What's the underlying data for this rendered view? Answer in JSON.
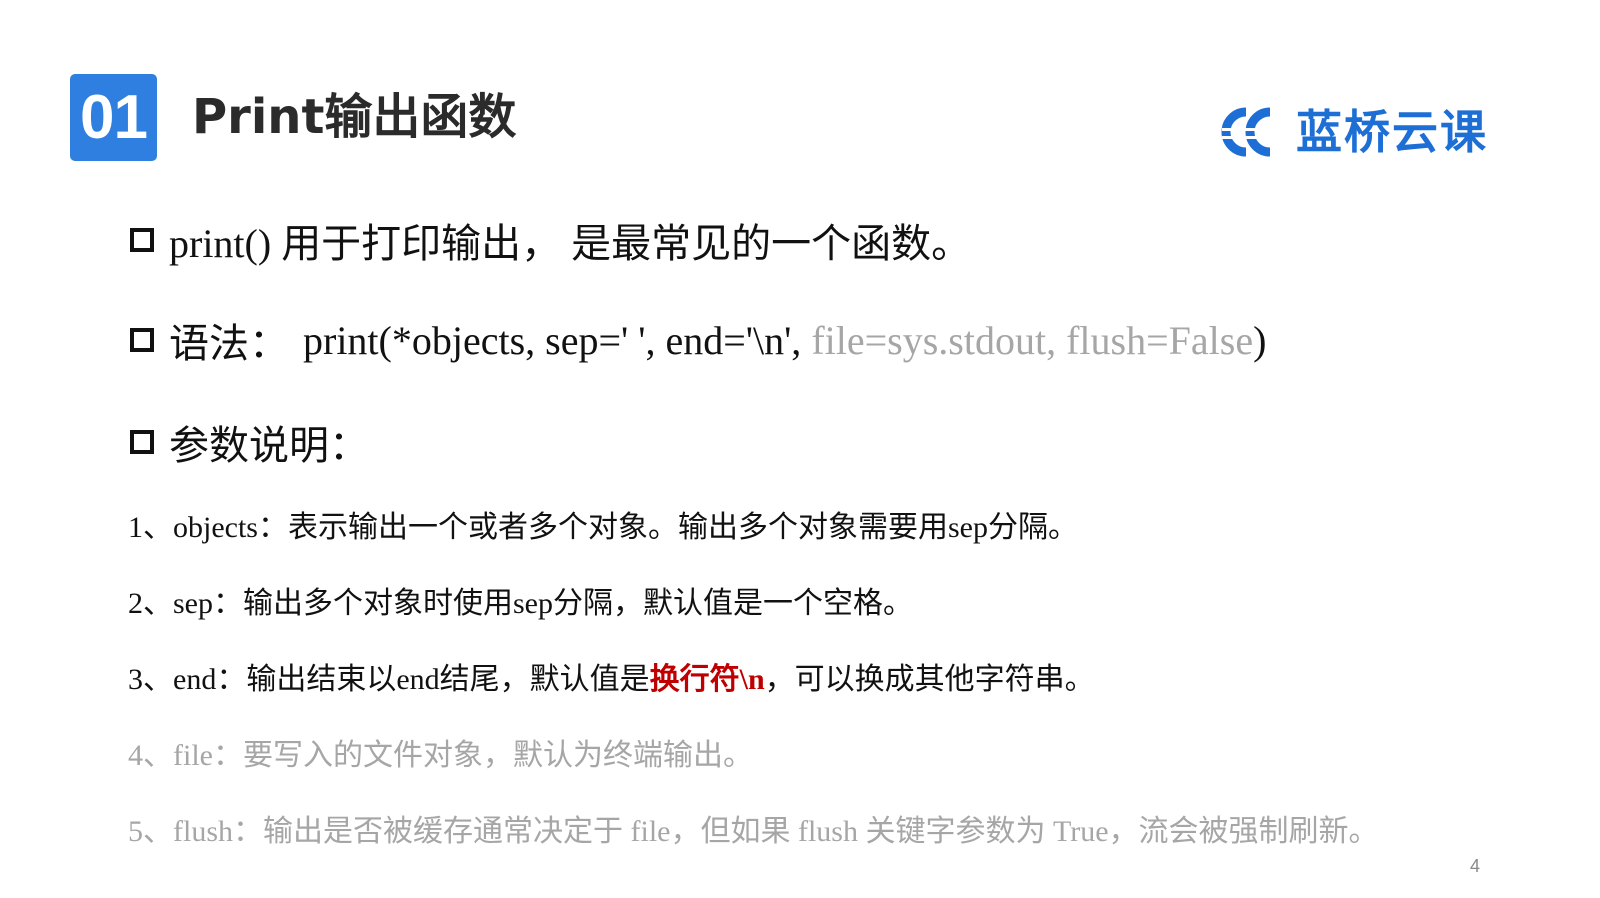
{
  "header": {
    "section_number": "01",
    "title": "Print输出函数",
    "logo_text": "蓝桥云课",
    "logo_icon": "lanqiao-logo-icon"
  },
  "bullets": [
    {
      "text": "print() 用于打印输出， 是最常见的一个函数。"
    },
    {
      "label": "语法：",
      "code_dark": "print(*objects, sep=' ', end='\\n', ",
      "code_gray": "file=sys.stdout, flush=False",
      "code_close": ")"
    },
    {
      "text": "参数说明："
    }
  ],
  "params": [
    {
      "text": "1、objects：表示输出一个或者多个对象。输出多个对象需要用sep分隔。"
    },
    {
      "text": "2、sep：输出多个对象时使用sep分隔，默认值是一个空格。"
    },
    {
      "pre": "3、end：输出结束以end结尾，默认值是",
      "highlight": "换行符\\n",
      "post": "，可以换成其他字符串。"
    },
    {
      "text": "4、file：要写入的文件对象，默认为终端输出。"
    },
    {
      "text": "5、flush：输出是否被缓存通常决定于 file，但如果 flush 关键字参数为 True，流会被强制刷新。"
    }
  ],
  "page_number": "4",
  "colors": {
    "badge": "#2f7fe0",
    "logo": "#1d6fd6",
    "highlight": "#c00000",
    "muted": "#a6a6a6"
  }
}
